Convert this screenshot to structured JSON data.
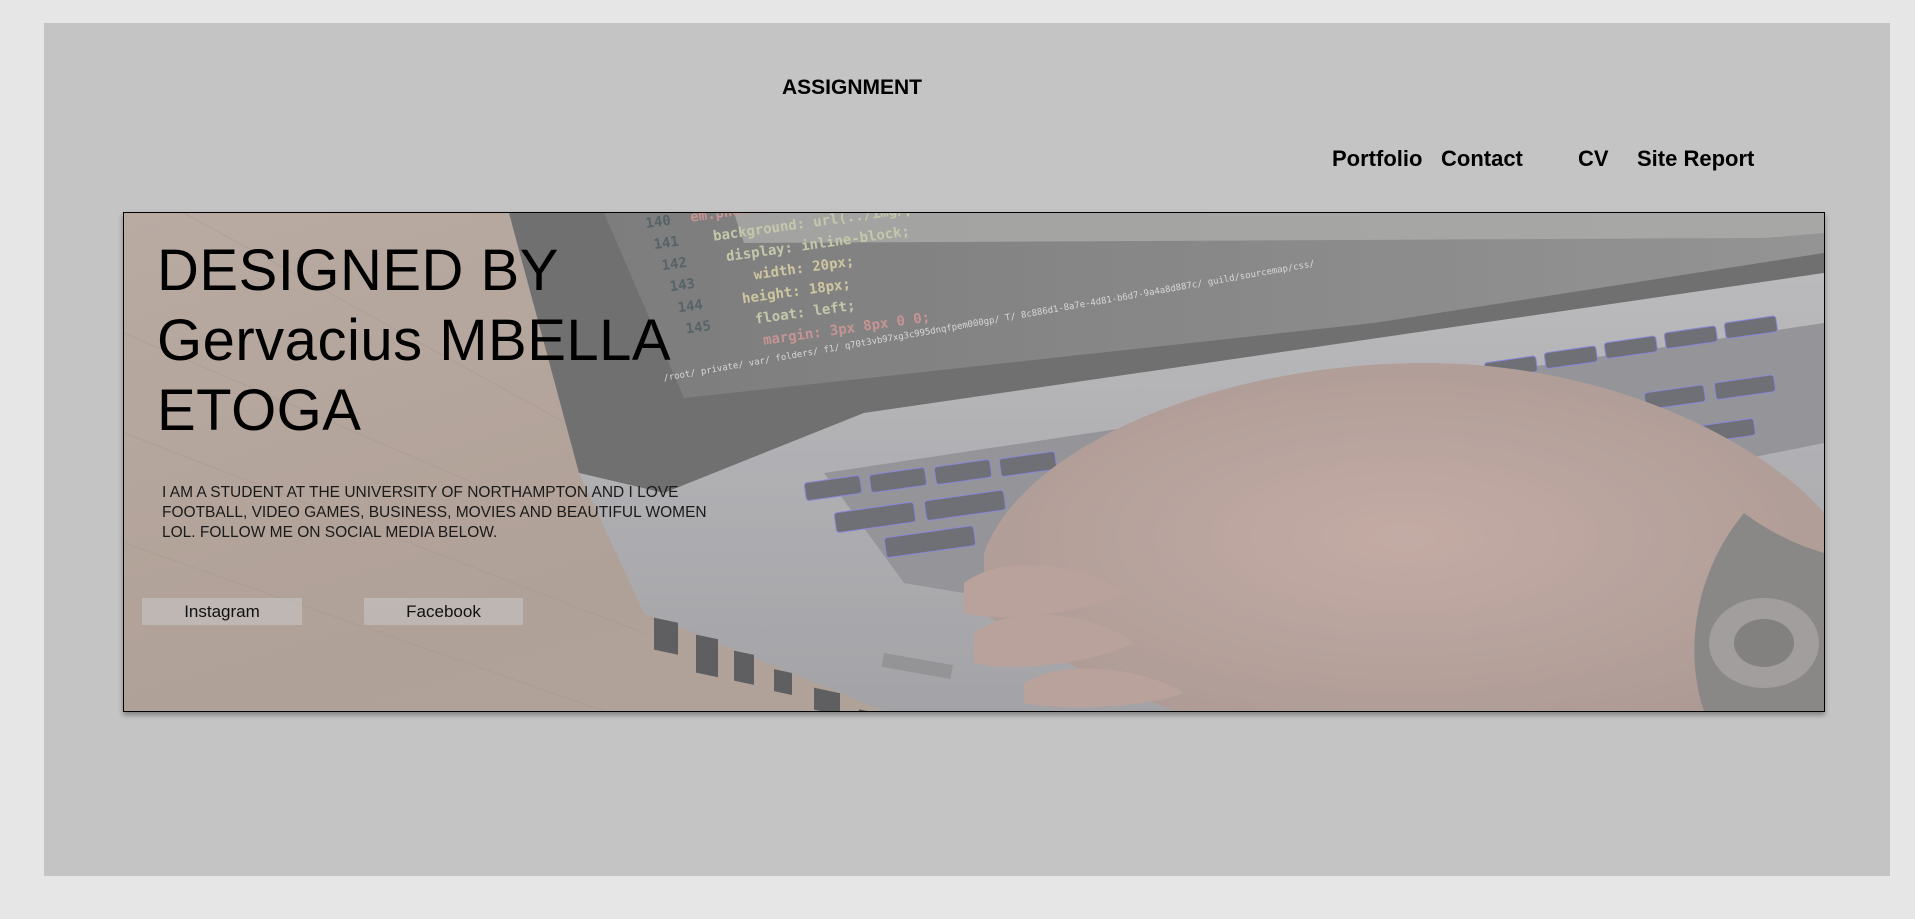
{
  "header": {
    "brand": "ASSIGNMENT"
  },
  "nav": {
    "items": [
      {
        "label": "Portfolio"
      },
      {
        "label": "Contact"
      },
      {
        "label": "CV"
      },
      {
        "label": "Site Report"
      }
    ]
  },
  "hero": {
    "title_lines": [
      "DESIGNED BY",
      "Gervacius MBELLA",
      "ETOGA"
    ],
    "bio": "I AM A STUDENT AT THE UNIVERSITY OF NORTHAMPTON AND I LOVE FOOTBALL, VIDEO GAMES, BUSINESS, MOVIES AND BEAUTIFUL WOMEN LOL. FOLLOW ME ON SOCIAL MEDIA BELOW.",
    "image_code_lines": [
      "em.phone{",
      "background: url(../img/ph",
      "display: inline-block;",
      "width: 20px;",
      "height: 18px;",
      "float: left;",
      "margin: 3px 8px 0 0;"
    ],
    "image_line_numbers": [
      "140",
      "141",
      "142",
      "143",
      "144",
      "145"
    ],
    "image_path_text": "/root/ private/ var/ folders/ f1/ q70t3vb97xg3c995dnqfpem000gp/ T/ 8c886d1-8a7e-4d81-b6d7-9a4a8d887c/ guild/sourcemap/css/",
    "buttons": {
      "instagram": "Instagram",
      "facebook": "Facebook"
    }
  },
  "colors": {
    "page_bg": "#e6e6e6",
    "panel_bg": "#c4c4c4",
    "text": "#000000"
  }
}
